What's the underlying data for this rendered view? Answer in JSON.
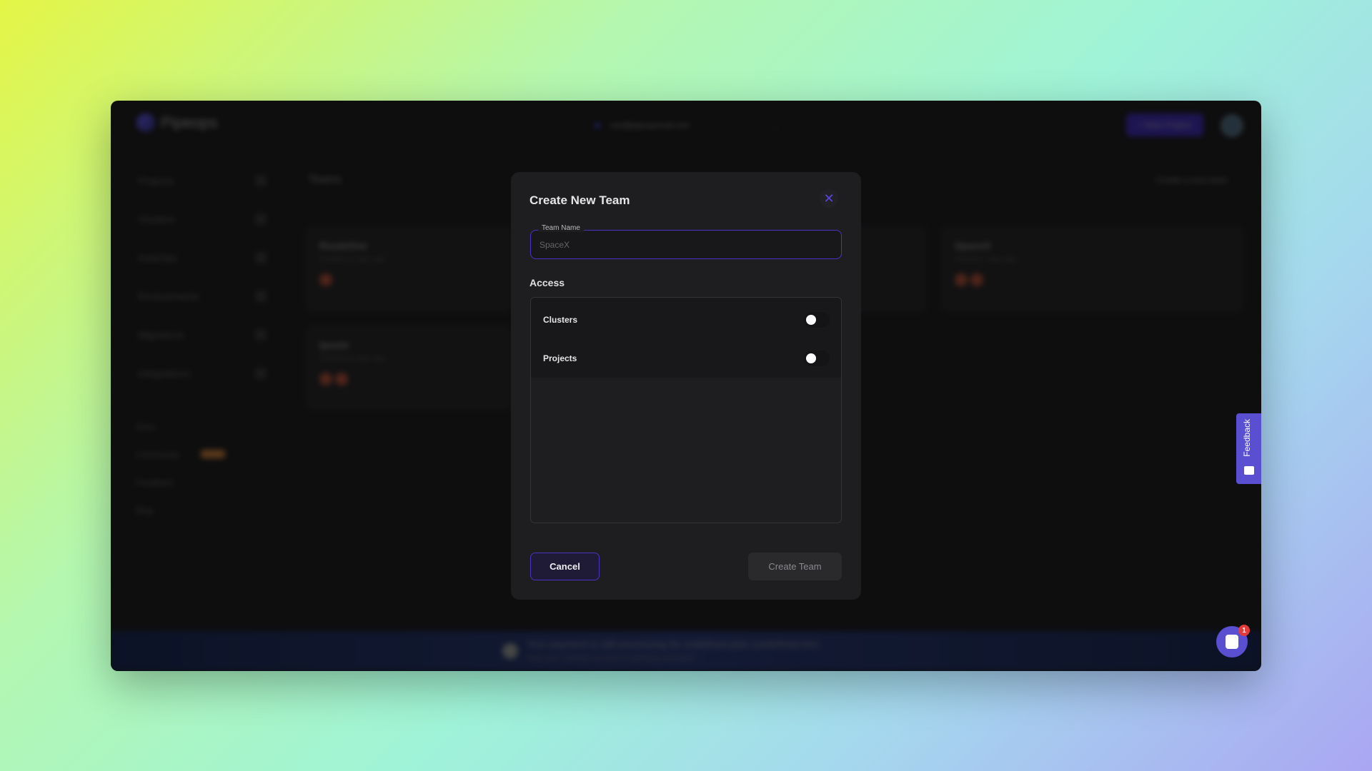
{
  "header": {
    "app_name": "Pipeops",
    "workspace": "ceo@pipeopsmail.com",
    "new_project": "+ New Project"
  },
  "sidebar": {
    "items": [
      {
        "label": "Projects"
      },
      {
        "label": "Clusters"
      },
      {
        "label": "AutoOps"
      },
      {
        "label": "Environments"
      },
      {
        "label": "Migrations"
      },
      {
        "label": "Integrations"
      }
    ],
    "links": [
      {
        "label": "Docs"
      },
      {
        "label": "Community"
      },
      {
        "label": "Feedback"
      },
      {
        "label": "Blog"
      }
    ]
  },
  "main": {
    "title": "Teams",
    "create_link": "Create a new team",
    "cards": [
      {
        "name": "RouteOne",
        "meta": "Created 11 days ago"
      },
      {
        "name": "Ipsum",
        "meta": "Created 11 days ago"
      },
      {
        "name": "SpaceX",
        "meta": "Created 1 days ago"
      }
    ]
  },
  "banner": {
    "text": "Your payment is still processing for undefined plan (undefined tier)",
    "sub": "Note your Pipeops account is pending activation"
  },
  "feedback_tab": "Feedback",
  "chat": {
    "badge": "1"
  },
  "modal": {
    "title": "Create New Team",
    "close_icon": "close-icon",
    "team_name": {
      "label": "Team Name",
      "value": "",
      "placeholder": "SpaceX"
    },
    "access_label": "Access",
    "access": [
      {
        "label": "Clusters",
        "enabled": false
      },
      {
        "label": "Projects",
        "enabled": false
      }
    ],
    "cancel": "Cancel",
    "create": "Create Team"
  },
  "colors": {
    "accent": "#4b32c3",
    "feedback": "#5a4fd0",
    "badge": "#e23b3b"
  }
}
